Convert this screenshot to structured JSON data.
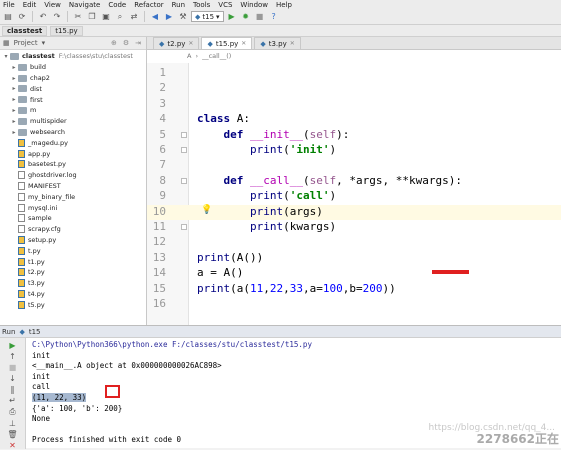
{
  "menubar": [
    "File",
    "Edit",
    "View",
    "Navigate",
    "Code",
    "Refactor",
    "Run",
    "Tools",
    "VCS",
    "Window",
    "Help"
  ],
  "toolbar": {
    "run_config": "t15",
    "icons": [
      "save-icon",
      "sync-icon",
      "undo-icon",
      "redo-icon",
      "cut-icon",
      "copy-icon",
      "paste-icon",
      "find-icon",
      "replace-icon",
      "back-icon",
      "forward-icon",
      "run-icon",
      "debug-icon",
      "stop-icon",
      "help-icon"
    ]
  },
  "breadcrumb": [
    "classtest",
    "t15.py"
  ],
  "project": {
    "header": "Project",
    "root": {
      "name": "classtest",
      "path": "F:\\classes\\stu\\classtest"
    },
    "items": [
      {
        "type": "folder",
        "name": "build"
      },
      {
        "type": "folder",
        "name": "chap2"
      },
      {
        "type": "folder",
        "name": "dist"
      },
      {
        "type": "folder",
        "name": "first"
      },
      {
        "type": "folder",
        "name": "m"
      },
      {
        "type": "folder",
        "name": "multispider"
      },
      {
        "type": "folder",
        "name": "websearch"
      },
      {
        "type": "py",
        "name": "_magedu.py"
      },
      {
        "type": "py",
        "name": "app.py"
      },
      {
        "type": "py",
        "name": "basetest.py"
      },
      {
        "type": "txt",
        "name": "ghostdriver.log"
      },
      {
        "type": "txt",
        "name": "MANIFEST"
      },
      {
        "type": "txt",
        "name": "my_binary_file"
      },
      {
        "type": "txt",
        "name": "mysql.ini"
      },
      {
        "type": "txt",
        "name": "sample"
      },
      {
        "type": "txt",
        "name": "scrapy.cfg"
      },
      {
        "type": "py",
        "name": "setup.py"
      },
      {
        "type": "py",
        "name": "t.py"
      },
      {
        "type": "py",
        "name": "t1.py"
      },
      {
        "type": "py",
        "name": "t2.py"
      },
      {
        "type": "py",
        "name": "t3.py"
      },
      {
        "type": "py",
        "name": "t4.py"
      },
      {
        "type": "py",
        "name": "t5.py"
      }
    ]
  },
  "editor": {
    "tabs": [
      {
        "label": "t2.py",
        "active": false
      },
      {
        "label": "t15.py",
        "active": true
      },
      {
        "label": "t3.py",
        "active": false
      }
    ],
    "structure_crumb": [
      "A",
      "__call__()"
    ],
    "current_line": 10,
    "lines": [
      {
        "n": "1",
        "html": ""
      },
      {
        "n": "2",
        "html": ""
      },
      {
        "n": "3",
        "html": ""
      },
      {
        "n": "4",
        "html": "<span class=\"kw\">class</span> A:"
      },
      {
        "n": "5",
        "html": "    <span class=\"kw\">def</span> <span class=\"fn\">__init__</span>(<span class=\"self\">self</span>):"
      },
      {
        "n": "6",
        "html": "        <span class=\"bi\">print</span>(<span class=\"str\">'init'</span>)"
      },
      {
        "n": "7",
        "html": ""
      },
      {
        "n": "8",
        "html": "    <span class=\"kw\">def</span> <span class=\"fn\">__call__</span>(<span class=\"self\">self</span>, *args, **kwargs):"
      },
      {
        "n": "9",
        "html": "        <span class=\"bi\">print</span>(<span class=\"str\">'call'</span>)"
      },
      {
        "n": "10",
        "html": "        <span class=\"bi\">print</span>(args)"
      },
      {
        "n": "11",
        "html": "        <span class=\"bi\">print</span>(kwargs)"
      },
      {
        "n": "12",
        "html": ""
      },
      {
        "n": "13",
        "html": "<span class=\"bi\">print</span>(A())"
      },
      {
        "n": "14",
        "html": "a = A()"
      },
      {
        "n": "15",
        "html": "<span class=\"bi\">print</span>(a(<span class=\"num\">11</span>,<span class=\"num\">22</span>,<span class=\"num\">33</span>,a=<span class=\"num\">100</span>,b=<span class=\"num\">200</span>))"
      },
      {
        "n": "16",
        "html": ""
      },
      {
        "n": "",
        "html": ""
      }
    ]
  },
  "run_panel": {
    "header_label": "Run",
    "tab_label": "t15",
    "console": [
      "C:\\Python\\Python366\\python.exe F:/classes/stu/classtest/t15.py",
      "init",
      "<__main__.A object at 0x000000000026AC898>",
      "init",
      "call",
      "(11, 22, 33)",
      "{'a': 100, 'b': 200}",
      "None",
      "",
      "Process finished with exit code 0"
    ]
  },
  "watermark": {
    "url": "https://blog.csdn.net/qq_4...",
    "text": "2278662正在"
  },
  "colors": {
    "highlight_line": "#fffae3",
    "selection": "#a6b8d0",
    "annotation_red": "#e02020"
  }
}
